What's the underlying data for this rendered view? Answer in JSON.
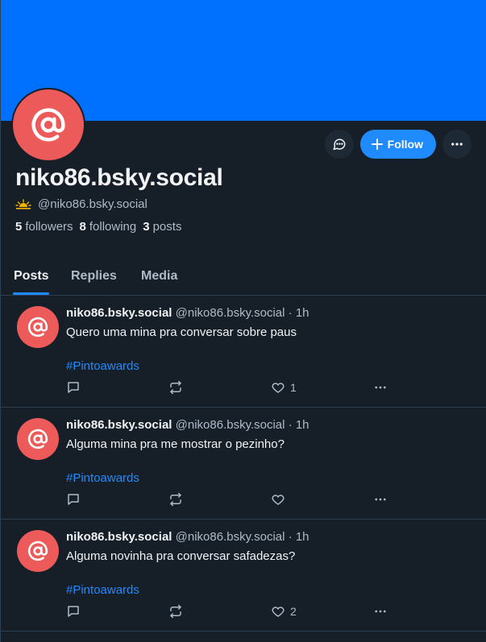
{
  "profile": {
    "display_name": "niko86.bsky.social",
    "handle": "@niko86.bsky.social",
    "followers_count": "5",
    "followers_label": "followers",
    "following_count": "8",
    "following_label": "following",
    "posts_count": "3",
    "posts_label": "posts"
  },
  "actions": {
    "follow_label": "Follow"
  },
  "tabs": [
    {
      "label": "Posts",
      "active": true
    },
    {
      "label": "Replies",
      "active": false
    },
    {
      "label": "Media",
      "active": false
    }
  ],
  "posts": [
    {
      "author": "niko86.bsky.social",
      "handle": "@niko86.bsky.social",
      "time": " · 1h",
      "text": "Quero uma mina pra conversar sobre paus",
      "tag": "#Pintoawards",
      "likes": "1"
    },
    {
      "author": "niko86.bsky.social",
      "handle": "@niko86.bsky.social",
      "time": " · 1h",
      "text": "Alguma mina pra me mostrar o pezinho?",
      "tag": "#Pintoawards",
      "likes": ""
    },
    {
      "author": "niko86.bsky.social",
      "handle": "@niko86.bsky.social",
      "time": " · 1h",
      "text": "Alguma novinha pra conversar safadezas?",
      "tag": "#Pintoawards",
      "likes": "2"
    }
  ],
  "colors": {
    "banner": "#0070ff",
    "avatar": "#ec5a5a",
    "accent": "#208bfe",
    "background": "#161e27",
    "muted_text": "#aebbc9",
    "divider": "#2e4052"
  },
  "icons": {
    "avatar": "at-sign-icon",
    "message": "chat-bubble-icon",
    "follow": "plus-icon",
    "more": "ellipsis-icon",
    "handle_badge": "sunrise-icon",
    "reply": "reply-icon",
    "repost": "repost-icon",
    "like": "heart-icon",
    "post_more": "ellipsis-icon"
  }
}
